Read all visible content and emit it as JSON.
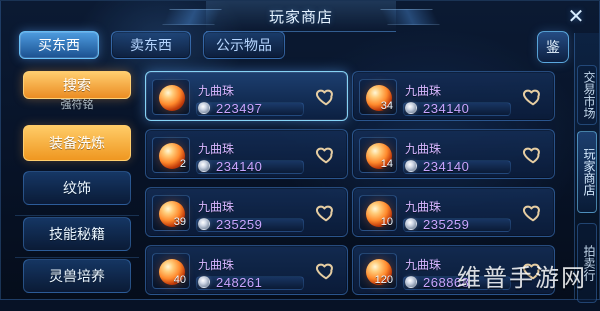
{
  "window": {
    "title": "玩家商店",
    "close_glyph": "✕"
  },
  "tabs": [
    {
      "label": "买东西",
      "active": true
    },
    {
      "label": "卖东西",
      "active": false
    },
    {
      "label": "公示物品",
      "active": false
    }
  ],
  "appraise": {
    "label": "鉴"
  },
  "left_menu": {
    "search_label": "搜索",
    "partial_label": "强符铭",
    "equip_label": "装备洗炼",
    "ornament_label": "纹饰",
    "skill_label": "技能秘籍",
    "pet_label": "灵兽培养"
  },
  "right_rail": {
    "trade_market": "交易市场",
    "player_shop": "玩家商店",
    "bottom_tab": "拍卖行"
  },
  "items": [
    {
      "name": "九曲珠",
      "qty": "",
      "price": "223497",
      "selected": true
    },
    {
      "name": "九曲珠",
      "qty": "34",
      "price": "234140",
      "selected": false
    },
    {
      "name": "九曲珠",
      "qty": "2",
      "price": "234140",
      "selected": false
    },
    {
      "name": "九曲珠",
      "qty": "14",
      "price": "234140",
      "selected": false
    },
    {
      "name": "九曲珠",
      "qty": "39",
      "price": "235259",
      "selected": false
    },
    {
      "name": "九曲珠",
      "qty": "10",
      "price": "235259",
      "selected": false
    },
    {
      "name": "九曲珠",
      "qty": "40",
      "price": "248261",
      "selected": false
    },
    {
      "name": "九曲珠",
      "qty": "120",
      "price": "268868",
      "selected": false
    }
  ],
  "watermark": "维普手游网",
  "colors": {
    "accent_blue": "#5aa7ff",
    "accent_orange": "#f3a531",
    "price_purple": "#c8a5ff",
    "heart_stroke": "#f2d7a8"
  }
}
